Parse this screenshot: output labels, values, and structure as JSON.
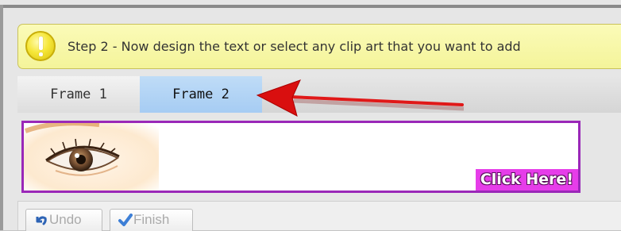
{
  "banner": {
    "step_text": "Step 2 - Now design the text or select any clip art that you want to add",
    "icon": "exclamation-warning-icon"
  },
  "tabs": [
    {
      "label": "Frame 1",
      "selected": false
    },
    {
      "label": "Frame 2",
      "selected": true
    }
  ],
  "preview": {
    "image": "eye-photo",
    "cta_label": "Click Here!",
    "border_color": "#9a28b8",
    "cta_color": "#e63de9"
  },
  "toolbar": {
    "undo_label": "Undo",
    "finish_label": "Finish"
  },
  "annotation": {
    "arrow_color": "#e01818"
  }
}
